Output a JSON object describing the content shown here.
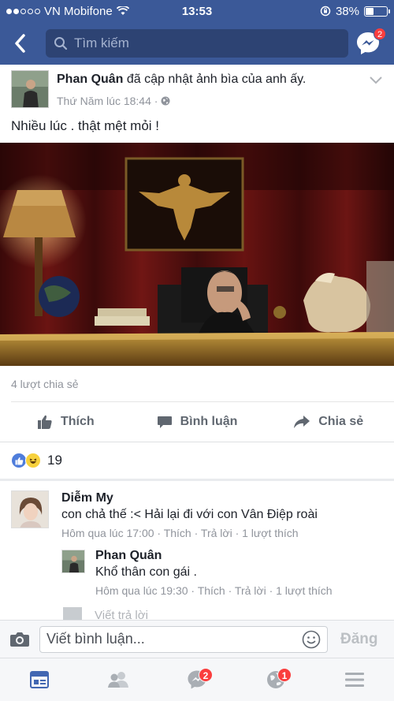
{
  "status_bar": {
    "carrier": "VN Mobifone",
    "time": "13:53",
    "battery_percent": "38%",
    "battery_level": 0.38,
    "signal_bars_filled": 2,
    "signal_bars_total": 5
  },
  "header": {
    "search_placeholder": "Tìm kiếm",
    "messenger_badge": "2",
    "bar_color": "#3b5998"
  },
  "post": {
    "author": "Phan Quân",
    "action": "đã cập nhật ảnh bìa của anh ấy.",
    "timestamp": "Thứ Năm lúc 18:44 ·",
    "text": "Nhiều lúc . thật mệt mỏi !",
    "shares": "4 lượt chia sẻ",
    "actions": {
      "like": "Thích",
      "comment": "Bình luận",
      "share": "Chia sẻ"
    },
    "reaction_count": "19"
  },
  "comments": [
    {
      "name": "Diễm My",
      "text": "con chả thế :< Hải lại đi với con Vân Điệp roài",
      "meta": "Hôm qua lúc 17:00 · Thích · Trả lời · 1 lượt thích"
    },
    {
      "name": "Phan Quân",
      "text": "Khổ thân con gái .",
      "meta": "Hôm qua lúc 19:30 · Thích · Trả lời · 1 lượt thích"
    }
  ],
  "reply_placeholder": "Viết trả lời",
  "composer": {
    "placeholder": "Viết bình luận...",
    "post_label": "Đăng"
  },
  "tabbar": {
    "messages_badge": "2",
    "notifications_badge": "1"
  }
}
